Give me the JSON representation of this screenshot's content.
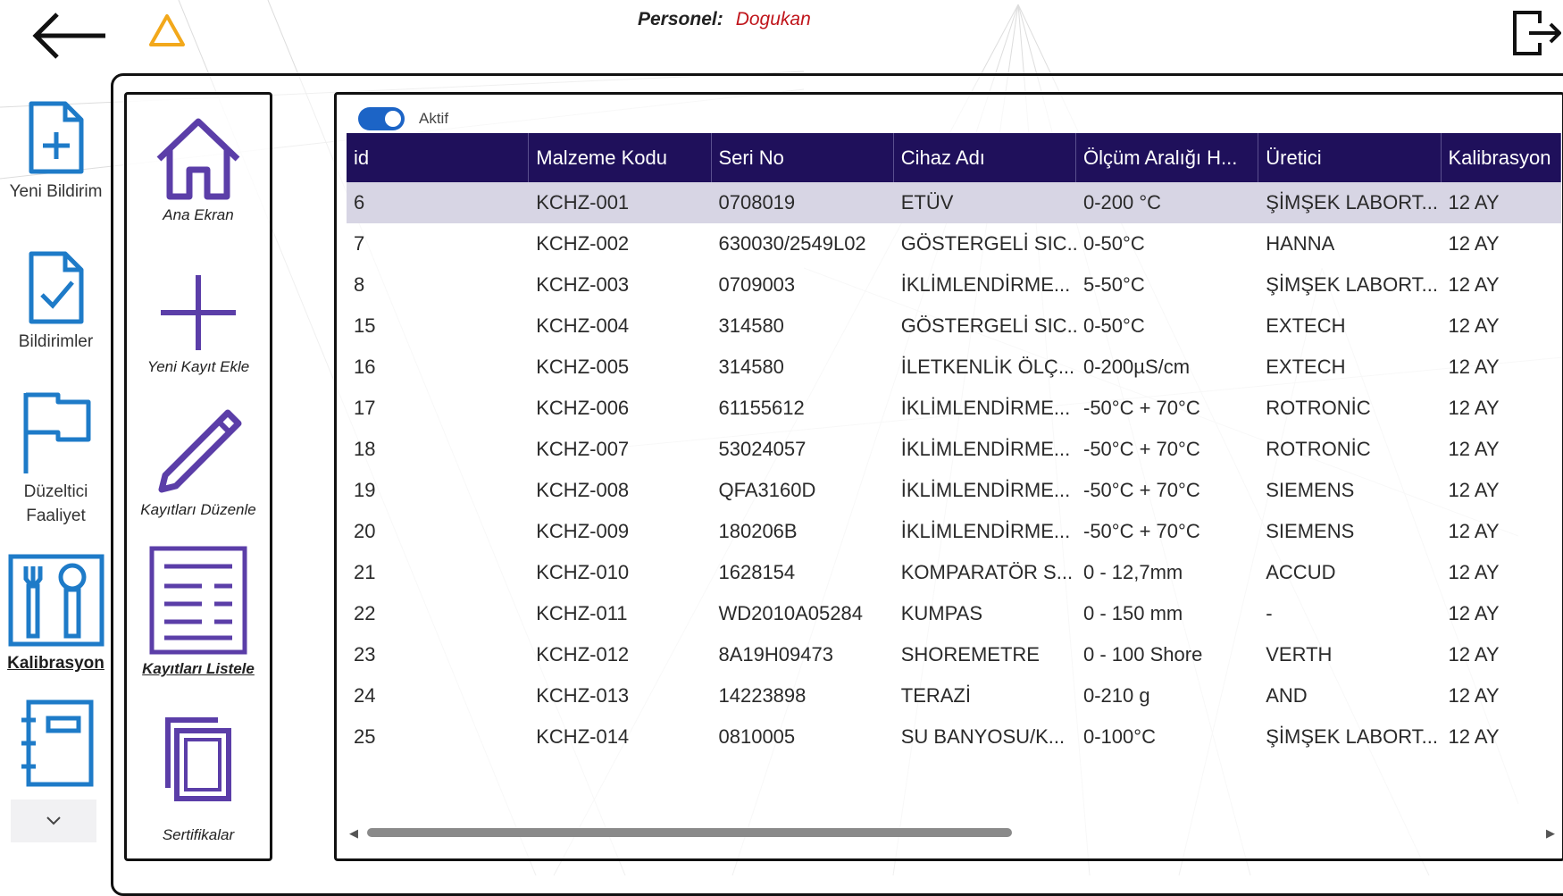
{
  "colors": {
    "accent": "#1f105b",
    "icon_blue": "#1e7bc8",
    "icon_purple": "#5b3ea8",
    "toggle_on": "#1c64c6",
    "personel_name": "#c0151b",
    "warning": "#f2a81b",
    "selected_row": "#d7d5e4"
  },
  "header": {
    "back_icon": "arrow-left-icon",
    "warning_icon": "warning-triangle-icon",
    "personel_label": "Personel:",
    "personel_name": "Dogukan",
    "logout_icon": "logout-icon"
  },
  "nav": {
    "items": [
      {
        "label": "Yeni Bildirim",
        "icon": "new-document-icon"
      },
      {
        "label": "Bildirimler",
        "icon": "checked-document-icon"
      },
      {
        "label": "Düzeltici",
        "label2": "Faaliyet",
        "icon": "flag-icon"
      },
      {
        "label": "Kalibrasyon",
        "icon": "tools-icon",
        "active": true
      },
      {
        "label": "",
        "icon": "notebook-icon"
      }
    ],
    "scroll_icon": "chevron-down-icon"
  },
  "submenu": {
    "items": [
      {
        "label": "Ana Ekran",
        "icon": "home-icon"
      },
      {
        "label": "Yeni Kayıt Ekle",
        "icon": "plus-icon"
      },
      {
        "label": "Kayıtları Düzenle",
        "icon": "pencil-icon"
      },
      {
        "label": "Kayıtları Listele",
        "icon": "list-icon",
        "active": true
      },
      {
        "label": "Sertifikalar",
        "icon": "copy-icon"
      }
    ]
  },
  "filter": {
    "toggle_label": "Aktif",
    "toggle_on": true
  },
  "table": {
    "columns": [
      "id",
      "Malzeme Kodu",
      "Seri No",
      "Cihaz Adı",
      "Ölçüm Aralığı H...",
      "Üretici",
      "Kalibrasyon"
    ],
    "rows": [
      [
        "6",
        "KCHZ-001",
        "0708019",
        "ETÜV",
        "0-200 °C",
        "ŞİMŞEK LABORT...",
        "12 AY"
      ],
      [
        "7",
        "KCHZ-002",
        "630030/2549L02",
        "GÖSTERGELİ SIC...",
        "0-50°C",
        "HANNA",
        "12 AY"
      ],
      [
        "8",
        "KCHZ-003",
        "0709003",
        "İKLİMLENDİRME...",
        "5-50°C",
        "ŞİMŞEK LABORT...",
        "12 AY"
      ],
      [
        "15",
        "KCHZ-004",
        "314580",
        "GÖSTERGELİ SIC...",
        "0-50°C",
        "EXTECH",
        "12 AY"
      ],
      [
        "16",
        "KCHZ-005",
        "314580",
        "İLETKENLİK ÖLÇ...",
        "0-200µS/cm",
        "EXTECH",
        "12 AY"
      ],
      [
        "17",
        "KCHZ-006",
        "61155612",
        "İKLİMLENDİRME...",
        "-50°C + 70°C",
        "ROTRONİC",
        "12 AY"
      ],
      [
        "18",
        "KCHZ-007",
        "53024057",
        "İKLİMLENDİRME...",
        "-50°C + 70°C",
        "ROTRONİC",
        "12 AY"
      ],
      [
        "19",
        "KCHZ-008",
        "QFA3160D",
        "İKLİMLENDİRME...",
        "-50°C + 70°C",
        "SIEMENS",
        "12 AY"
      ],
      [
        "20",
        "KCHZ-009",
        "180206B",
        "İKLİMLENDİRME...",
        "-50°C + 70°C",
        "SIEMENS",
        "12 AY"
      ],
      [
        "21",
        "KCHZ-010",
        "1628154",
        "KOMPARATÖR S...",
        "0 - 12,7mm",
        "ACCUD",
        "12 AY"
      ],
      [
        "22",
        "KCHZ-011",
        "WD2010A05284",
        "KUMPAS",
        "0 - 150 mm",
        "-",
        "12 AY"
      ],
      [
        "23",
        "KCHZ-012",
        "8A19H09473",
        "SHOREMETRE",
        "0 - 100 Shore",
        "VERTH",
        "12 AY"
      ],
      [
        "24",
        "KCHZ-013",
        "14223898",
        "TERAZİ",
        "0-210 g",
        "AND",
        "12 AY"
      ],
      [
        "25",
        "KCHZ-014",
        "0810005",
        "SU BANYOSU/K...",
        "0-100°C",
        "ŞİMŞEK LABORT...",
        "12 AY"
      ]
    ],
    "selected_row": 0
  }
}
